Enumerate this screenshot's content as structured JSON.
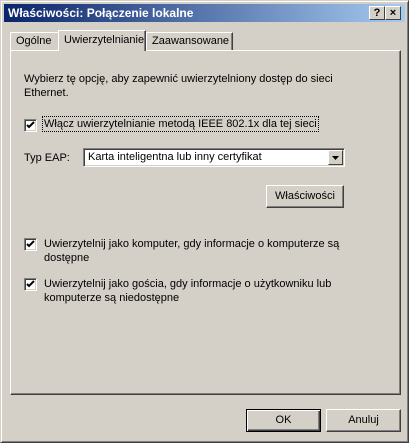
{
  "window": {
    "title": "Właściwości: Połączenie lokalne",
    "help_button": "?",
    "close_button": "×"
  },
  "tabs": [
    {
      "label": "Ogólne"
    },
    {
      "label": "Uwierzytelnianie"
    },
    {
      "label": "Zaawansowane"
    }
  ],
  "auth": {
    "description": "Wybierz tę opcję, aby zapewnić uwierzytelniony dostęp do sieci\nEthernet.",
    "enable_8021x": {
      "label": "Włącz uwierzytelnianie metodą IEEE 802.1x dla tej sieci",
      "checked": true
    },
    "eap_type_label": "Typ EAP:",
    "eap_type_value": "Karta inteligentna lub inny certyfikat",
    "properties_button": "Właściwości",
    "auth_as_computer": {
      "label": "Uwierzytelnij jako komputer, gdy informacje o komputerze są\ndostępne",
      "checked": true
    },
    "auth_as_guest": {
      "label": "Uwierzytelnij jako gościa, gdy informacje o użytkowniku lub\nkomputerze są niedostępne",
      "checked": true
    }
  },
  "footer": {
    "ok": "OK",
    "cancel": "Anuluj"
  }
}
